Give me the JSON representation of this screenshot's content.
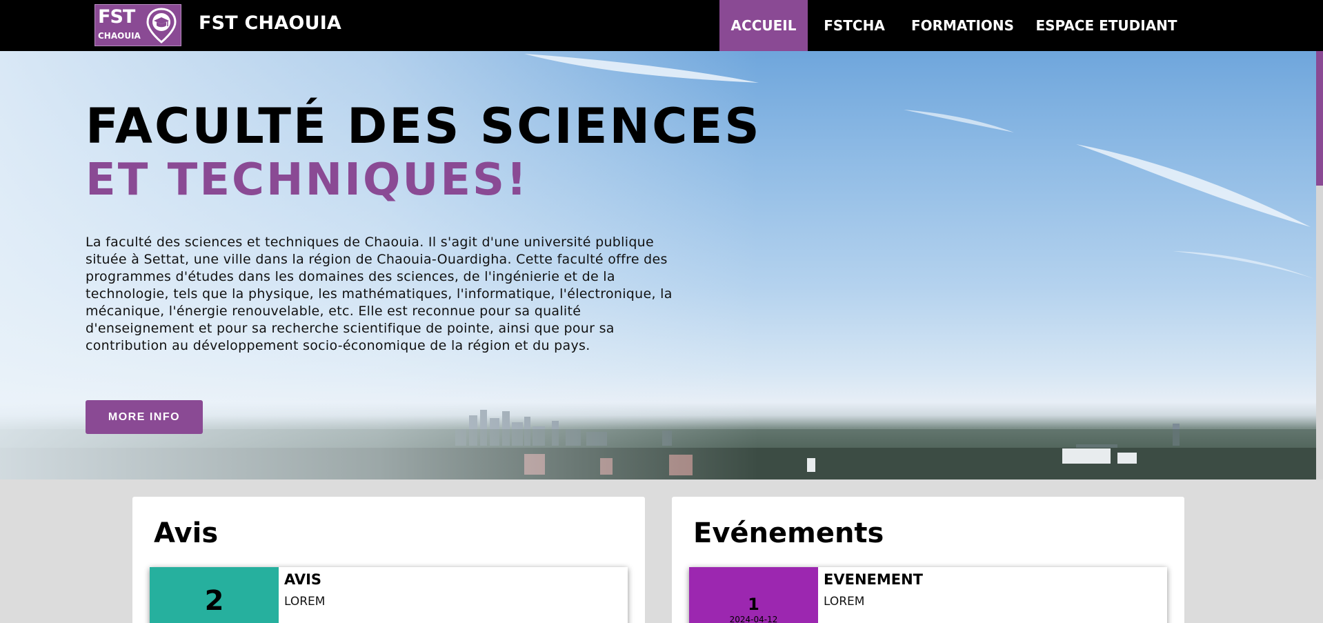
{
  "navbar": {
    "logo": {
      "line1": "FST",
      "line2": "CHAOUIA"
    },
    "brand": "FST CHAOUIA",
    "items": [
      {
        "label": "ACCUEIL",
        "active": true
      },
      {
        "label": "FSTCHA",
        "active": false
      },
      {
        "label": "FORMATIONS",
        "active": false
      },
      {
        "label": "ESPACE ETUDIANT",
        "active": false
      }
    ]
  },
  "hero": {
    "title_line1": "FACULTÉ DES SCIENCES",
    "title_line2": "ET TECHNIQUES!",
    "description": "La faculté des sciences et techniques de Chaouia. Il s'agit d'une université publique située à Settat, une ville dans la région de Chaouia-Ouardigha. Cette faculté offre des programmes d'études dans les domaines des sciences, de l'ingénierie et de la technologie, tels que la physique, les mathématiques, l'informatique, l'électronique, la mécanique, l'énergie renouvelable, etc. Elle est reconnue pour sa qualité d'enseignement et pour sa recherche scientifique de pointe, ainsi que pour sa contribution au développement socio-économique de la région et du pays.",
    "button_label": "MORE INFO"
  },
  "avis": {
    "title": "Avis",
    "item": {
      "number": "2",
      "heading": "AVIS",
      "text": "LOREM"
    }
  },
  "evenements": {
    "title": "Evénements",
    "item": {
      "number": "1",
      "date": "2024-04-12",
      "heading": "EVENEMENT",
      "text": "LOREM"
    }
  },
  "colors": {
    "accent": "#8a4a94",
    "avis_number_bg": "#26b09e",
    "event_number_bg": "#9c27b0",
    "navbar_bg": "#000000"
  },
  "icons": {
    "logo_pin": "graduation-cap-pin-icon"
  }
}
